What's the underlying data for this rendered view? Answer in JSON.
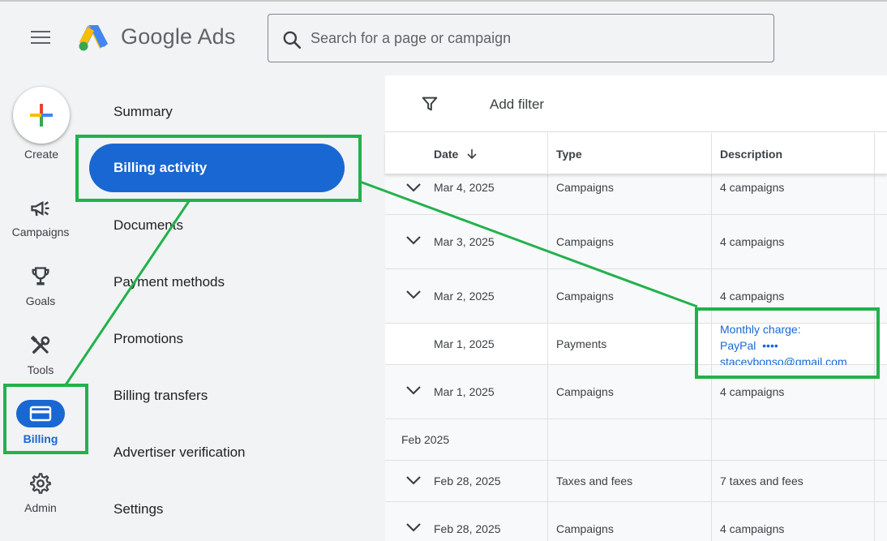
{
  "header": {
    "brand": "Google Ads",
    "search_placeholder": "Search for a page or campaign"
  },
  "rail": {
    "create_label": "Create",
    "items": [
      {
        "label": "Campaigns",
        "icon": "megaphone-icon"
      },
      {
        "label": "Goals",
        "icon": "trophy-icon"
      },
      {
        "label": "Tools",
        "icon": "tools-icon"
      },
      {
        "label": "Billing",
        "icon": "credit-card-icon"
      },
      {
        "label": "Admin",
        "icon": "gear-icon"
      }
    ]
  },
  "subnav": {
    "items": [
      "Summary",
      "Billing activity",
      "Documents",
      "Payment methods",
      "Promotions",
      "Billing transfers",
      "Advertiser verification",
      "Settings"
    ],
    "active": "Billing activity"
  },
  "table": {
    "add_filter": "Add filter",
    "columns": [
      "Date",
      "Type",
      "Description"
    ],
    "rows": [
      {
        "date": "Mar 4, 2025",
        "type": "Campaigns",
        "description": "4 campaigns"
      },
      {
        "date": "Mar 3, 2025",
        "type": "Campaigns",
        "description": "4 campaigns"
      },
      {
        "date": "Mar 2, 2025",
        "type": "Campaigns",
        "description": "4 campaigns"
      },
      {
        "date": "Mar 1, 2025",
        "type": "Payments",
        "desc_line1": "Monthly charge:",
        "desc_line2": "PayPal  ••••",
        "desc_line3": "staceybonso@gmail.com"
      },
      {
        "date": "Mar 1, 2025",
        "type": "Campaigns",
        "description": "4 campaigns"
      },
      {
        "group": "Feb 2025"
      },
      {
        "date": "Feb 28, 2025",
        "type": "Taxes and fees",
        "description": "7 taxes and fees"
      },
      {
        "date": "Feb 28, 2025",
        "type": "Campaigns",
        "description": "4 campaigns"
      }
    ]
  },
  "colors": {
    "accent": "#1967d2",
    "annotation": "#22b14c"
  }
}
